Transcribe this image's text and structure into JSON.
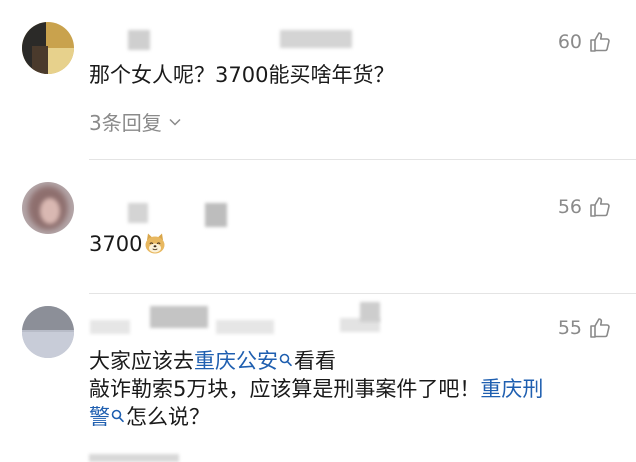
{
  "comments": [
    {
      "likes": "60",
      "text": "那个女人呢？3700能买啥年货？",
      "replies": "3条回复"
    },
    {
      "likes": "56",
      "text": "3700",
      "emoji_icon": "doge-face-icon"
    },
    {
      "likes": "55",
      "text_a": "大家应该去",
      "link_a": "重庆公安",
      "text_b": "看看",
      "text_c": "敲诈勒索5万块，应该算是刑事案件了吧！",
      "link_b_line1": "重庆刑",
      "link_b_line2": "警",
      "text_d": "怎么说？"
    }
  ],
  "icons": {
    "like": "thumbs-up-icon",
    "search": "search-icon",
    "expand": "chevron-down-icon"
  },
  "colors": {
    "link": "#1f5fb0",
    "meta": "#8a8a8a",
    "text": "#1a1a1a",
    "divider": "#e4e4e4"
  }
}
